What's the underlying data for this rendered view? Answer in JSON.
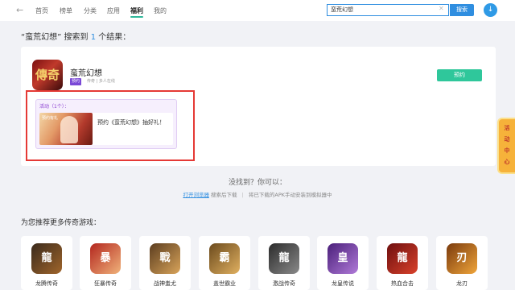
{
  "nav": {
    "back_icon": "back-arrow-icon",
    "items": [
      {
        "label": "首页"
      },
      {
        "label": "榜单"
      },
      {
        "label": "分类"
      },
      {
        "label": "应用"
      },
      {
        "label": "福利"
      },
      {
        "label": "我的"
      }
    ],
    "active_index": 4,
    "search_value": "蛮荒幻想",
    "search_button": "搜索",
    "accent": "#2f8ee0"
  },
  "result": {
    "prefix": "“蛮荒幻想” 搜索到 ",
    "count": "1",
    "suffix": " 个结果："
  },
  "app": {
    "icon_text": "傳奇",
    "name": "蛮荒幻想",
    "badge": "预约",
    "meta": "传奇 | 多人在线",
    "action": "预约",
    "action_color": "#2fc79b"
  },
  "activity": {
    "title": "活动（1个）：",
    "thumb_tag": "预约有礼",
    "text": "预约《蛮荒幻想》抽好礼！",
    "highlight_color": "#e53935"
  },
  "help": {
    "title": "没找到？你可以：",
    "link": "打开浏览器",
    "after_link": "搜索后下载",
    "separator": "|",
    "hint": "将已下载的APK手动安装到模拟器中"
  },
  "recommend": {
    "title": "为您推荐更多传奇游戏：",
    "items": [
      {
        "name": "龙腾传奇",
        "glyph": "龍"
      },
      {
        "name": "狂暴传奇",
        "glyph": "暴"
      },
      {
        "name": "战神蚩尤",
        "glyph": "戰"
      },
      {
        "name": "盖世霸业",
        "glyph": "霸"
      },
      {
        "name": "激战传奇",
        "glyph": "龍"
      },
      {
        "name": "龙皇传说",
        "glyph": "皇"
      },
      {
        "name": "热血合击",
        "glyph": "龍"
      },
      {
        "name": "龙刃",
        "glyph": "刃"
      }
    ]
  },
  "side_tab": {
    "chars": [
      "活",
      "动",
      "中",
      "心"
    ]
  }
}
